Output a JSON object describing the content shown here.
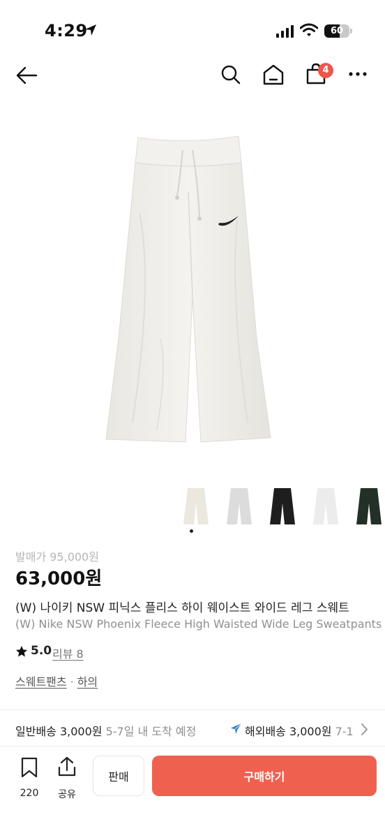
{
  "status_bar": {
    "time": "4:29",
    "battery": "60",
    "battery_level": 0.6
  },
  "nav": {
    "cart_badge": "4"
  },
  "product": {
    "original_price": "발매가 95,000원",
    "price": "63,000원",
    "title_ko": "(W) 나이키 NSW 피닉스 플리스 하이 웨이스트 와이드 레그 스웨트",
    "title_en": "(W) Nike NSW Phoenix Fleece High Waisted Wide Leg Sweatpants",
    "rating": "5.0",
    "review_label": "리뷰 8",
    "categories": [
      "스웨트팬츠",
      "하의"
    ],
    "category_separator": "·",
    "thumbnail_colors": [
      "#ece8df",
      "#dcdcdc",
      "#1e1e1e",
      "#ececec",
      "#233028"
    ]
  },
  "shipping": {
    "domestic_label": "일반배송 3,000원",
    "domestic_eta": "5-7일 내 도착 예정",
    "overseas_label": "해외배송 3,000원",
    "overseas_eta": "7-1"
  },
  "bottom_bar": {
    "bookmark_count": "220",
    "share_label": "공유",
    "sell_label": "판매",
    "buy_label": "구매하기"
  },
  "colors": {
    "accent": "#f0604f",
    "badge": "#f0554a"
  }
}
